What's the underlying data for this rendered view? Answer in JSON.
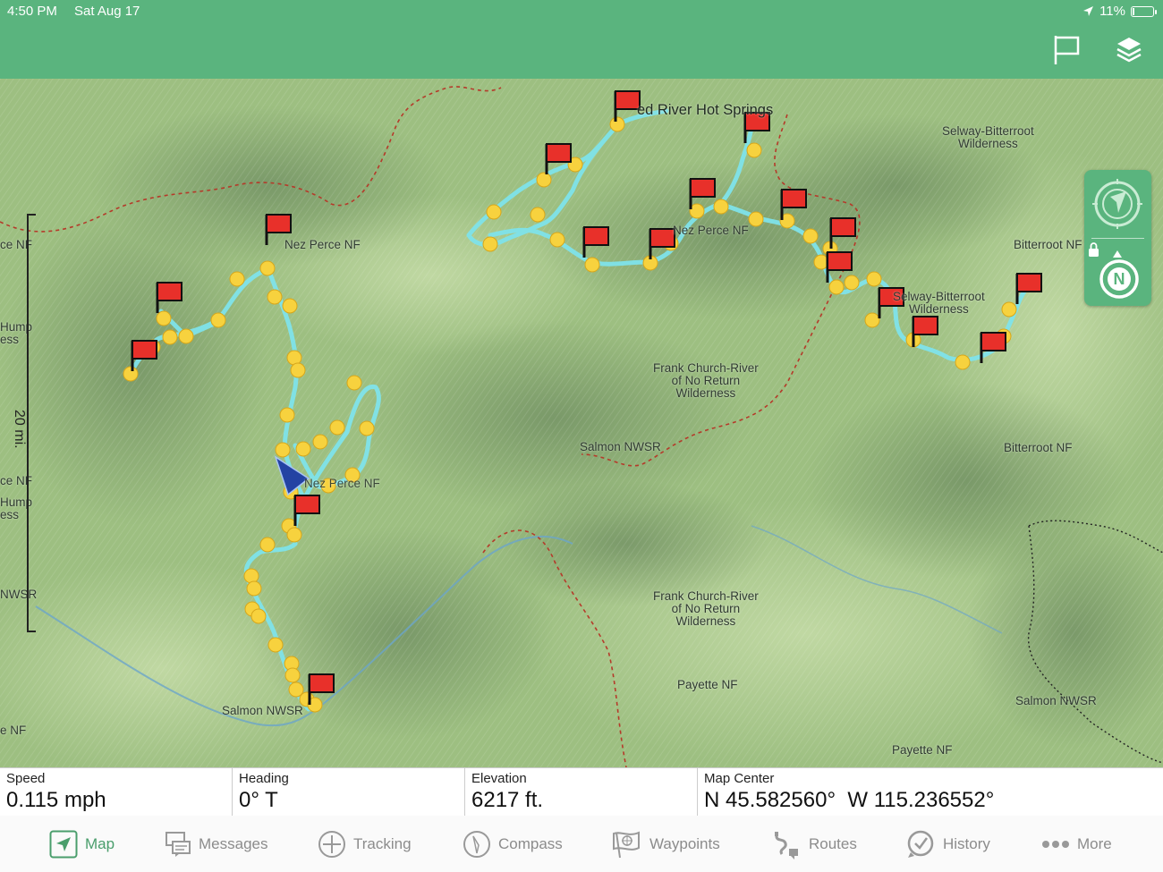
{
  "status": {
    "time": "4:50 PM",
    "date": "Sat Aug 17",
    "battery": "11%"
  },
  "header": {
    "flag_icon": "flag-icon",
    "layers_icon": "layers-icon"
  },
  "map": {
    "scale_label": "20 mi.",
    "labels": {
      "red_river": "ed River Hot Springs",
      "selway_top": "Selway-Bitterroot\nWilderness",
      "nez_perce_1": "Nez Perce NF",
      "nez_perce_2": "Nez Perce NF",
      "nez_perce_3": "Nez Perce NF",
      "bitterroot_1": "Bitterroot NF",
      "selway_mid": "Selway-Bitterroot\nWilderness",
      "frank_1": "Frank Church-River\nof No Return\nWilderness",
      "salmon_1": "Salmon NWSR",
      "bitterroot_2": "Bitterroot NF",
      "frank_2": "Frank Church-River\nof No Return\nWilderness",
      "payette_1": "Payette NF",
      "salmon_2": "Salmon NWSR",
      "salmon_3": "Salmon NWSR",
      "payette_2": "Payette NF",
      "edge_1": "ce NF",
      "edge_2": "Hump\ness",
      "edge_3": "ce NF",
      "edge_4": "Hump\ness",
      "edge_5": "NWSR",
      "edge_6": "e NF"
    },
    "colors": {
      "track": "#7fe3ea",
      "waypoint": "#f7d23e",
      "flag": "#e8302a",
      "position": "#2443a3",
      "accent": "#5ab47e"
    }
  },
  "data_panel": [
    {
      "label": "Speed",
      "value": "0.115 mph"
    },
    {
      "label": "Heading",
      "value": "0° T"
    },
    {
      "label": "Elevation",
      "value": "6217 ft."
    },
    {
      "label": "Map Center",
      "value": "N 45.582560°  W 115.236552°"
    }
  ],
  "tabs": [
    {
      "label": "Map",
      "icon": "map-arrow-icon",
      "active": true
    },
    {
      "label": "Messages",
      "icon": "messages-icon"
    },
    {
      "label": "Tracking",
      "icon": "tracking-icon"
    },
    {
      "label": "Compass",
      "icon": "compass-icon"
    },
    {
      "label": "Waypoints",
      "icon": "waypoints-icon"
    },
    {
      "label": "Routes",
      "icon": "routes-icon"
    },
    {
      "label": "History",
      "icon": "history-icon"
    },
    {
      "label": "More",
      "icon": "more-icon"
    }
  ]
}
